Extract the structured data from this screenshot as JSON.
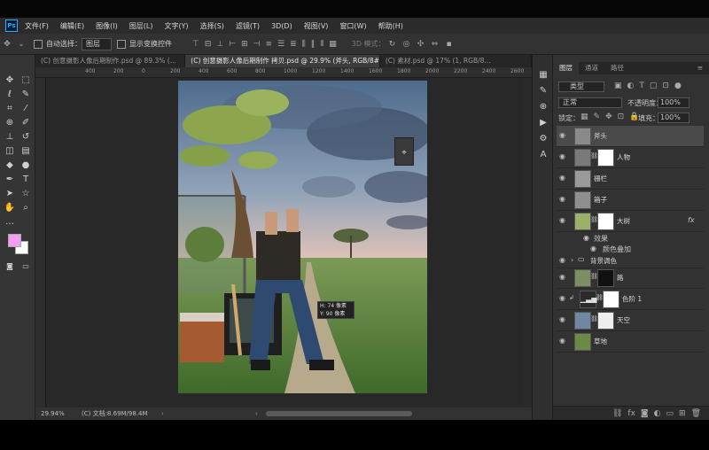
{
  "app": {
    "logo": "Ps"
  },
  "menu": [
    "文件(F)",
    "编辑(E)",
    "图像(I)",
    "图层(L)",
    "文字(Y)",
    "选择(S)",
    "滤镜(T)",
    "3D(D)",
    "视图(V)",
    "窗口(W)",
    "帮助(H)"
  ],
  "options": {
    "auto_select_label": "自动选择：",
    "auto_select_value": "图层",
    "transform_label": "显示变换控件",
    "mode_3d": "3D 模式："
  },
  "tabs": [
    {
      "label": "(C) 创意摄影人像后期制作.psd @ 89.3% (..."
    },
    {
      "label": "(C) 创意摄影人像后期制作 拷贝.psd @ 29.9% (斧头, RGB/8#) *"
    },
    {
      "label": "(C) 素材.psd @ 17% (1, RGB/8..."
    }
  ],
  "rulers": [
    "400",
    "200",
    "0",
    "200",
    "400",
    "600",
    "800",
    "1000",
    "1200",
    "1400",
    "1600",
    "1800",
    "2000",
    "2200",
    "2400",
    "2600",
    "2800"
  ],
  "status": {
    "zoom": "29.94%",
    "doc": "(C) 文档:8.69M/98.4M"
  },
  "tooltip": {
    "line1": "H: 74 像素",
    "line2": "Y: 90 像素"
  },
  "layers_panel": {
    "tabs": [
      "图层",
      "通道",
      "路径"
    ],
    "filter_label": "类型",
    "blend_mode": "正常",
    "opacity_label": "不透明度：",
    "opacity_value": "100%",
    "lock_label": "锁定：",
    "fill_label": "填充：",
    "fill_value": "100%",
    "layers": [
      {
        "name": "斧头"
      },
      {
        "name": "人物"
      },
      {
        "name": "栅栏"
      },
      {
        "name": "箱子"
      },
      {
        "name": "大树"
      },
      {
        "name": "效果"
      },
      {
        "name": "颜色叠加"
      },
      {
        "name": "背景调色"
      },
      {
        "name": "路"
      },
      {
        "name": "色阶 1"
      },
      {
        "name": "天空"
      },
      {
        "name": "草地"
      }
    ]
  },
  "colors": {
    "foreground": "#f79cf0",
    "background": "#ffffff",
    "accent": "#31a8ff"
  }
}
